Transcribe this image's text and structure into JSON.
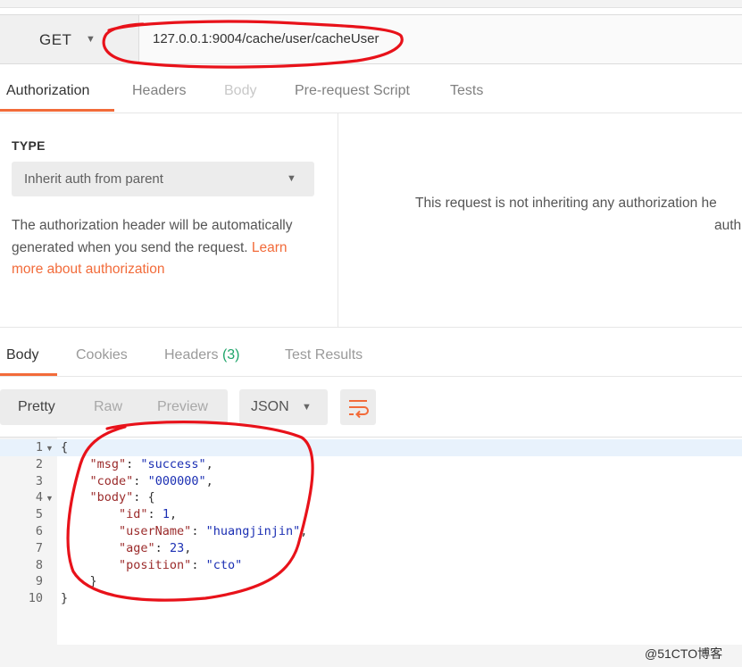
{
  "request": {
    "method": "GET",
    "url": "127.0.0.1:9004/cache/user/cacheUser"
  },
  "request_tabs": [
    {
      "label": "Authorization",
      "active": true
    },
    {
      "label": "Headers"
    },
    {
      "label": "Body"
    },
    {
      "label": "Pre-request Script"
    },
    {
      "label": "Tests"
    }
  ],
  "auth": {
    "type_label": "TYPE",
    "type_value": "Inherit auth from parent",
    "description": "The authorization header will be automatically generated when you send the request.",
    "link": "Learn more about authorization",
    "message_line1": "This request is not inheriting any authorization he",
    "message_line2": "auth"
  },
  "response_tabs": {
    "body": "Body",
    "cookies": "Cookies",
    "headers": "Headers",
    "headers_count": "(3)",
    "test_results": "Test Results"
  },
  "view": {
    "pretty": "Pretty",
    "raw": "Raw",
    "preview": "Preview",
    "format": "JSON"
  },
  "response_body": {
    "msg": "success",
    "code": "000000",
    "body": {
      "id": 1,
      "userName": "huangjinjin",
      "age": 23,
      "position": "cto"
    }
  },
  "line_numbers": [
    "1",
    "2",
    "3",
    "4",
    "5",
    "6",
    "7",
    "8",
    "9",
    "10"
  ],
  "code": {
    "open_brace": "{",
    "close_brace": "}",
    "k_msg": "\"msg\"",
    "v_msg": "\"success\"",
    "k_code": "\"code\"",
    "v_code": "\"000000\"",
    "k_body": "\"body\"",
    "k_id": "\"id\"",
    "v_id": "1",
    "k_user": "\"userName\"",
    "v_user": "\"huangjinjin\"",
    "k_age": "\"age\"",
    "v_age": "23",
    "k_pos": "\"position\"",
    "v_pos": "\"cto\""
  },
  "watermark": "@51CTO博客",
  "colors": {
    "accent": "#f26b3a",
    "annotation": "#e8121a",
    "headers_count": "#1fa56a"
  }
}
